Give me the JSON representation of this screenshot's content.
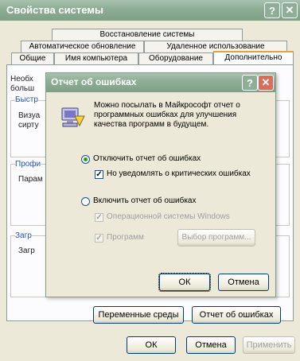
{
  "main": {
    "title": "Свойства системы",
    "help_glyph": "?",
    "close_glyph": "✕",
    "tabs_row1": [
      "Восстановление системы"
    ],
    "tabs_row2": [
      "Автоматическое обновление",
      "Удаленное использование"
    ],
    "tabs_row3": [
      "Общие",
      "Имя компьютера",
      "Оборудование",
      "Дополнительно"
    ],
    "bg_texts": [
      "Необх",
      "больш",
      "Быстр",
      "Визуа",
      "сирту",
      "Профи",
      "Парам",
      "Загр",
      "Загр"
    ],
    "perf_buttons": [
      "Переменные среды",
      "Отчет об ошибках"
    ],
    "bottom_buttons": [
      "ОК",
      "Отмена",
      "Применить"
    ]
  },
  "dialog": {
    "title": "Отчет об ошибках",
    "help_glyph": "?",
    "close_glyph": "✕",
    "info_text": [
      "Можно посылать в Майкрософт отчет о",
      "программных ошибках для улучшения",
      "качества программ в будущем."
    ],
    "disable_radio": "Отключить отчет об ошибках",
    "notify_checkbox": "Но уведомлять о критических ошибках",
    "enable_radio": "Включить отчет об ошибках",
    "os_checkbox": "Операционной системы Windows",
    "programs_checkbox": "Программ",
    "choose_button": "Выбор программ...",
    "ok": "ОК",
    "cancel": "Отмена",
    "check_glyph": "✓"
  }
}
